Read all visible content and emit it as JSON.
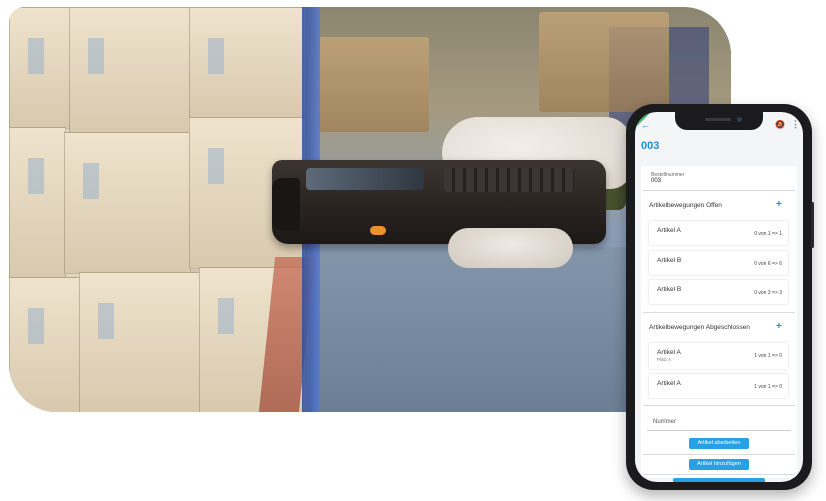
{
  "app": {
    "title": "003"
  },
  "form": {
    "field_label": "Bestellnummer",
    "field_value": "003"
  },
  "open_section": {
    "title": "Artikelbewegungen Offen",
    "items": [
      {
        "name": "Artikel A",
        "count": "0 von 1 => 1"
      },
      {
        "name": "Artikel B",
        "count": "0 von 6 => 6"
      },
      {
        "name": "Artikel B",
        "count": "0 von 3 => 3"
      }
    ]
  },
  "closed_section": {
    "title": "Artikelbewegungen Abgeschlossen",
    "items": [
      {
        "name": "Artikel A",
        "sub": "Platz A",
        "count": "1 von 1 => 0"
      },
      {
        "name": "Artikel A",
        "count": "1 von 1 => 0"
      }
    ]
  },
  "nummer": {
    "label": "Nummer"
  },
  "buttons": {
    "process": "Artikel abarbeiten",
    "add": "Artikel hinzufügen"
  },
  "icons": {
    "back": "back-arrow-icon",
    "bell": "bell-off-icon",
    "menu": "more-vertical-icon",
    "plus": "plus-icon"
  },
  "colors": {
    "accent": "#1b8fd8",
    "button": "#29a0e6",
    "corner": "#3cb66a"
  }
}
